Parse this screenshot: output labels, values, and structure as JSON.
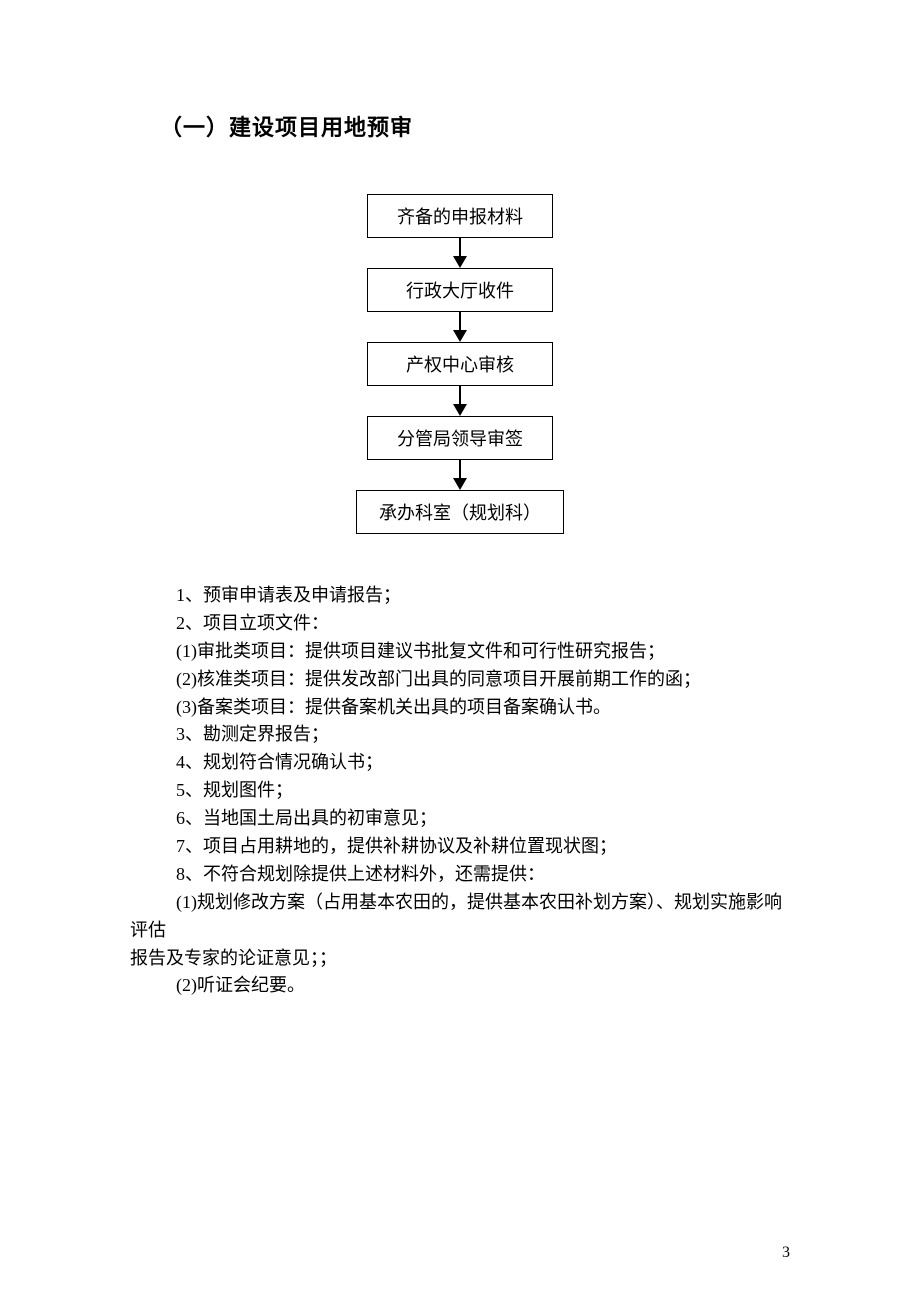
{
  "title": "（一）建设项目用地预审",
  "flowchart": {
    "steps": [
      "齐备的申报材料",
      "行政大厅收件",
      "产权中心审核",
      "分管局领导审签",
      "承办科室（规划科）"
    ]
  },
  "lines": [
    {
      "cls": "list-line",
      "text": "1、预审申请表及申请报告；"
    },
    {
      "cls": "list-line",
      "text": "2、项目立项文件："
    },
    {
      "cls": "sub-line",
      "text": "(1)审批类项目：提供项目建议书批复文件和可行性研究报告；"
    },
    {
      "cls": "sub-line",
      "text": "(2)核准类项目：提供发改部门出具的同意项目开展前期工作的函；"
    },
    {
      "cls": "sub-line",
      "text": "(3)备案类项目：提供备案机关出具的项目备案确认书。"
    },
    {
      "cls": "list-line",
      "text": "3、勘测定界报告；"
    },
    {
      "cls": "list-line",
      "text": "4、规划符合情况确认书；"
    },
    {
      "cls": "list-line",
      "text": "5、规划图件；"
    },
    {
      "cls": "list-line",
      "text": "6、当地国土局出具的初审意见；"
    },
    {
      "cls": "list-line",
      "text": "7、项目占用耕地的，提供补耕协议及补耕位置现状图；"
    },
    {
      "cls": "list-line",
      "text": "8、不符合规划除提供上述材料外，还需提供："
    },
    {
      "cls": "para-line para-indent",
      "text": "(1)规划修改方案（占用基本农田的，提供基本农田补划方案）、规划实施影响评估"
    },
    {
      "cls": "para-line",
      "text": "报告及专家的论证意见；；"
    },
    {
      "cls": "sub-line",
      "text": "(2)听证会纪要。"
    }
  ],
  "page_number": "3"
}
